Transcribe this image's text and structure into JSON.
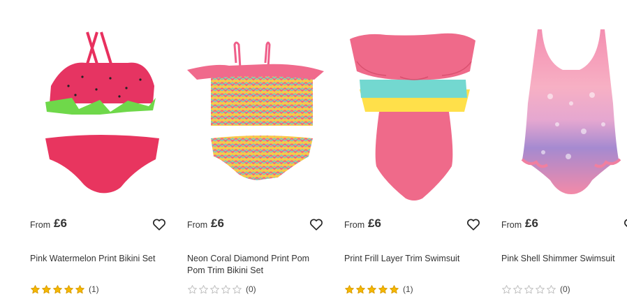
{
  "products": [
    {
      "from_label": "From",
      "price": "£6",
      "name": "Pink Watermelon Print Bikini Set",
      "rating": 5,
      "review_count": "(1)",
      "wishlist_icon": "heart-outline-icon"
    },
    {
      "from_label": "From",
      "price": "£6",
      "name": "Neon Coral Diamond Print Pom Pom Trim Bikini Set",
      "rating": 0,
      "review_count": "(0)",
      "wishlist_icon": "heart-outline-icon"
    },
    {
      "from_label": "From",
      "price": "£6",
      "name": "Print Frill Layer Trim Swimsuit",
      "rating": 5,
      "review_count": "(1)",
      "wishlist_icon": "heart-outline-icon"
    },
    {
      "from_label": "From",
      "price": "£6",
      "name": "Pink Shell Shimmer Swimsuit",
      "rating": 0,
      "review_count": "(0)",
      "wishlist_icon": "heart-outline-icon"
    }
  ],
  "colors": {
    "star_filled": "#f5b800",
    "star_empty_outline": "#bdbdbd",
    "text": "#333333"
  }
}
